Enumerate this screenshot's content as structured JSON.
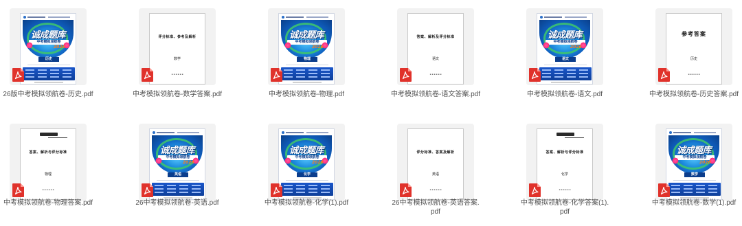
{
  "files": [
    {
      "name": "26版中考模拟领航卷-历史.pdf",
      "kind": "cover",
      "cover_subject": "历史",
      "icon": "pdf-icon"
    },
    {
      "name": "中考模拟领航卷-数学答案.pdf",
      "kind": "answer",
      "heading": "评分标准、参考及解析",
      "subject": "数学",
      "icon": "pdf-icon"
    },
    {
      "name": "中考模拟领航卷-物理.pdf",
      "kind": "cover",
      "cover_subject": "物理",
      "icon": "pdf-icon"
    },
    {
      "name": "中考模拟领航卷-语文答案.pdf",
      "kind": "answer",
      "heading": "答案、解析及评分标准",
      "subject": "语文",
      "icon": "pdf-icon"
    },
    {
      "name": "中考模拟领航卷-语文.pdf",
      "kind": "cover",
      "cover_subject": "语文",
      "icon": "pdf-icon"
    },
    {
      "name": "中考模拟领航卷-历史答案.pdf",
      "kind": "answer",
      "heading": "参考答案",
      "subject": "历史",
      "icon": "pdf-icon"
    },
    {
      "name": "中考模拟领航卷-物理答案.pdf",
      "kind": "answer",
      "heading": "答案、解析与评分标准",
      "subject": "物理",
      "icon": "pdf-icon"
    },
    {
      "name": "26中考模拟领航卷-英语.pdf",
      "kind": "cover",
      "cover_subject": "英语",
      "icon": "pdf-icon"
    },
    {
      "name": "中考模拟领航卷-化学(1).pdf",
      "kind": "cover",
      "cover_subject": "化学",
      "icon": "pdf-icon"
    },
    {
      "name": "26中考模拟领航卷-英语答案.pdf",
      "kind": "answer",
      "heading": "评分标准、答案及解析",
      "subject": "英语",
      "icon": "pdf-icon"
    },
    {
      "name": "中考模拟领航卷-化学答案(1).pdf",
      "kind": "answer",
      "heading": "答案、解析与评分标准",
      "subject": "化学",
      "icon": "pdf-icon"
    },
    {
      "name": "中考模拟领航卷-数学(1).pdf",
      "kind": "cover",
      "cover_subject": "数学",
      "icon": "pdf-icon"
    }
  ],
  "cover": {
    "brand": "诚成题库",
    "ribbon": "中考模拟领航卷",
    "year": "2026"
  },
  "colors": {
    "pdf_red": "#e0322b",
    "label_gray": "#505050",
    "tile_bg": "#f2f2f2"
  }
}
